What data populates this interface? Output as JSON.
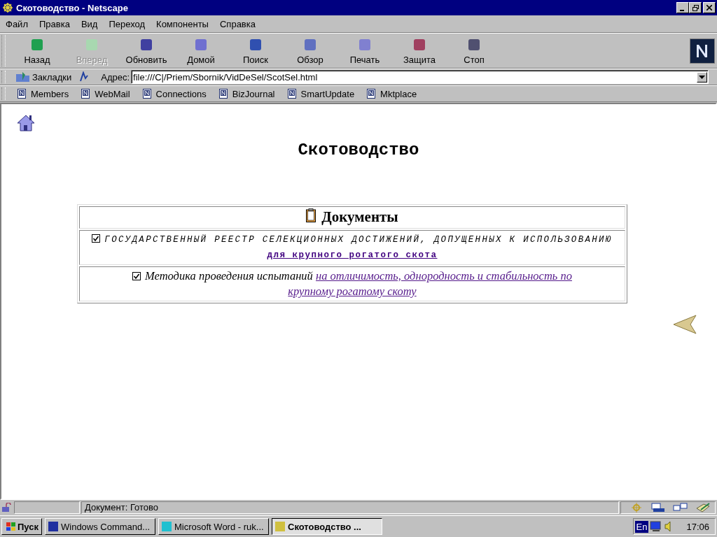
{
  "window": {
    "title": "Скотоводство - Netscape"
  },
  "menu": [
    "Файл",
    "Правка",
    "Вид",
    "Переход",
    "Компоненты",
    "Справка"
  ],
  "toolbar": [
    {
      "label": "Назад",
      "disabled": false
    },
    {
      "label": "Вперед",
      "disabled": true
    },
    {
      "label": "Обновить",
      "disabled": false
    },
    {
      "label": "Домой",
      "disabled": false
    },
    {
      "label": "Поиск",
      "disabled": false
    },
    {
      "label": "Обзор",
      "disabled": false
    },
    {
      "label": "Печать",
      "disabled": false
    },
    {
      "label": "Защита",
      "disabled": false
    },
    {
      "label": "Стоп",
      "disabled": false
    }
  ],
  "location": {
    "bookmarks": "Закладки",
    "address_label": "Адрес:",
    "url": "file:///C|/Priem/Sbornik/VidDeSel/ScotSel.html"
  },
  "personal_toolbar": [
    "Members",
    "WebMail",
    "Connections",
    "BizJournal",
    "SmartUpdate",
    "Mktplace"
  ],
  "page": {
    "title": "Скотоводство",
    "table_heading": "Документы",
    "rows": [
      {
        "kind": "mono",
        "text": "ГОСУДАРСТВЕННЫЙ РЕЕСТР СЕЛЕКЦИОННЫХ ДОСТИЖЕНИЙ, ДОПУЩЕННЫХ К ИСПОЛЬЗОВАНИЮ",
        "link": "для крупного рогатого скота"
      },
      {
        "kind": "italic",
        "text": "Методика проведения испытаний",
        "link_lines": [
          "на отличимость, однородность и стабильность по",
          "крупному рогатому скоту"
        ]
      }
    ]
  },
  "status_bar": {
    "text": "Документ: Готово"
  },
  "taskbar": {
    "start": "Пуск",
    "tasks": [
      {
        "label": "Windows Command...",
        "selected": false
      },
      {
        "label": "Microsoft Word - ruk...",
        "selected": false
      },
      {
        "label": "Скотоводство ...",
        "selected": true
      }
    ],
    "language": "En",
    "clock": "17:06"
  }
}
